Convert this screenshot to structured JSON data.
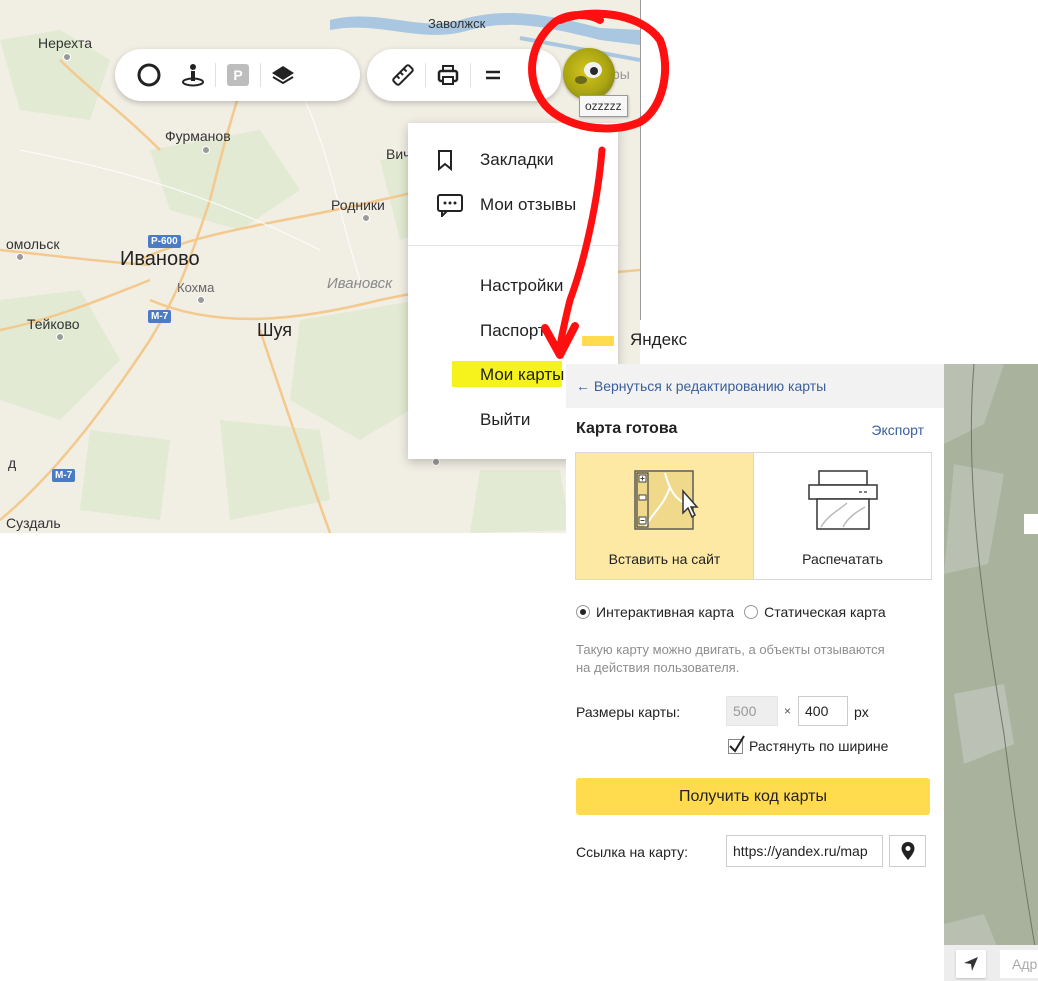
{
  "map": {
    "cities": {
      "zavolzhsk": "Заволжск",
      "nerekhta": "Нерехта",
      "furmanov": "Фурманов",
      "vichuga": "Вич",
      "rodniki": "Родники",
      "komsomolsk": "омольск",
      "ivanovo": "Иваново",
      "kokhma": "Кохма",
      "region": "Ивановск",
      "teikovo": "Тейково",
      "shuya": "Шуя",
      "d_edge": "д",
      "suzdal": "Суздаль",
      "ry_edge": "ры"
    },
    "shields": {
      "r600": "Р-600",
      "m7a": "М-7",
      "m7b": "М-7"
    },
    "toolbar_icons": [
      "traffic-icon",
      "panorama-icon",
      "parking-icon",
      "layers-icon",
      "ruler-icon",
      "print-icon",
      "menu-icon"
    ],
    "parking_glyph": "P",
    "avatar_tooltip": "ozzzzz",
    "user_menu": {
      "items": [
        "Закладки",
        "Мои отзывы"
      ],
      "items2": [
        "Настройки",
        "Паспорт",
        "Мои карты",
        "Выйти"
      ]
    },
    "highlight_color": "#f6f31c"
  },
  "yandex_header": "Яндекс",
  "panel": {
    "back_link": "← Вернуться к редактированию карты",
    "title": "Карта готова",
    "export": "Экспорт",
    "card_embed": "Вставить на сайт",
    "card_print": "Распечатать",
    "radio_interactive": "Интерактивная карта",
    "radio_static": "Статическая карта",
    "description": "Такую карту можно двигать, а объекты отзываются на действия пользователя.",
    "sizes_label": "Размеры карты:",
    "width_value": "500",
    "times": "×",
    "height_value": "400",
    "unit": "px",
    "stretch_label": "Растянуть по ширине",
    "stretch_checked": true,
    "get_code": "Получить код карты",
    "link_label": "Ссылка на карту:",
    "link_value": "https://yandex.ru/map",
    "accent_color": "#ffdb4d"
  },
  "right_strip": {
    "address_placeholder": "Адр"
  },
  "annotation": {
    "color": "#ff1010"
  }
}
